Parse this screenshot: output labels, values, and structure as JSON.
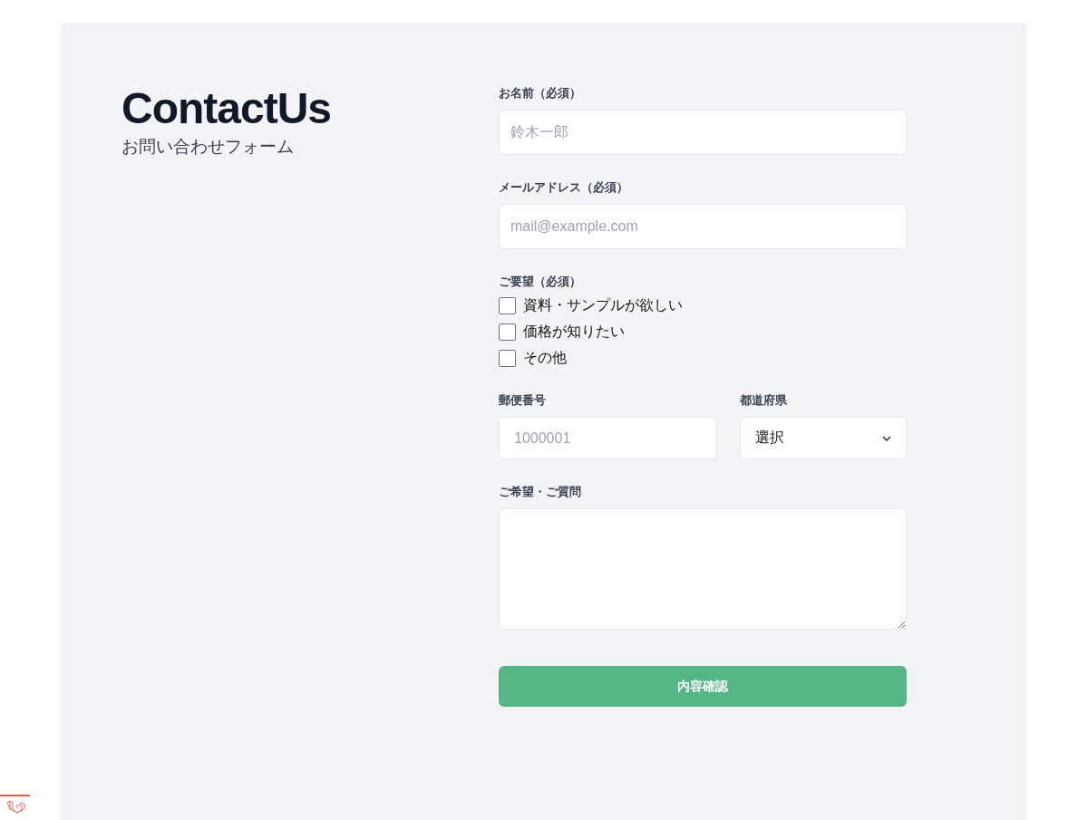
{
  "header": {
    "title": "ContactUs",
    "subtitle": "お問い合わせフォーム"
  },
  "fields": [
    {
      "kind": "text",
      "label": "お名前（必須）",
      "placeholder": "鈴木一郎"
    },
    {
      "kind": "text",
      "label": "メールアドレス（必須）",
      "placeholder": "mail@example.com"
    },
    {
      "kind": "checkboxes",
      "label": "ご要望（必須）",
      "options": [
        {
          "label": "資料・サンプルが欲しい",
          "checked": false
        },
        {
          "label": "価格が知りたい",
          "checked": false
        },
        {
          "label": "その他",
          "checked": false
        }
      ]
    },
    {
      "kind": "pair",
      "items": [
        {
          "kind": "text",
          "label": "郵便番号",
          "placeholder": "1000001"
        },
        {
          "kind": "select",
          "label": "都道府県",
          "value": "選択"
        }
      ]
    },
    {
      "kind": "textarea",
      "label": "ご希望・ご質問"
    }
  ],
  "submit": {
    "label": "内容確認"
  }
}
